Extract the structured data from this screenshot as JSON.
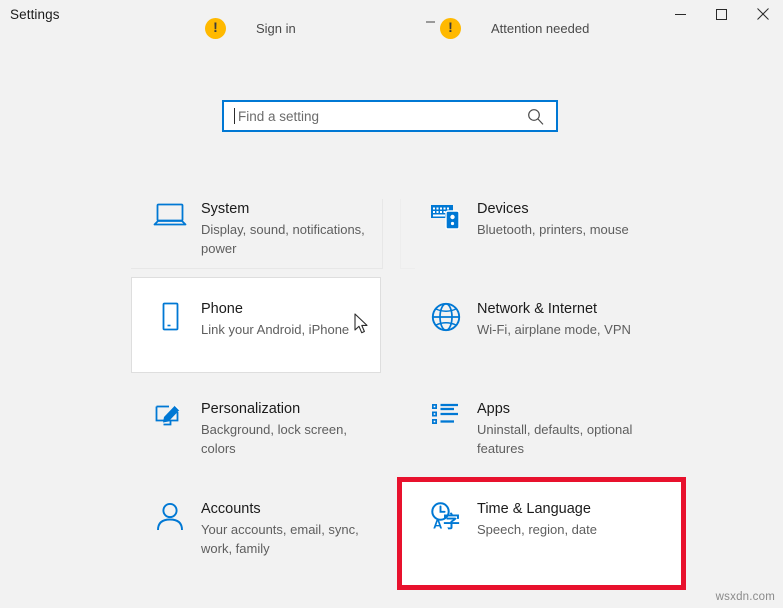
{
  "window": {
    "title": "Settings",
    "controls": [
      {
        "name": "minimize",
        "glyph": "minimize-icon"
      },
      {
        "name": "maximize",
        "glyph": "maximize-icon"
      },
      {
        "name": "close",
        "glyph": "close-icon"
      }
    ]
  },
  "header_strip": {
    "items": [
      {
        "icon": "warning-icon",
        "label": "Sign in"
      },
      {
        "icon": "warning-icon",
        "label": "Attention needed"
      }
    ]
  },
  "search": {
    "placeholder": "Find a setting",
    "value": "",
    "icon": "search-icon"
  },
  "tiles": [
    {
      "icon": "system-monitor-icon",
      "title": "System",
      "subtitle": "Display, sound, notifications, power",
      "hovered": false
    },
    {
      "icon": "devices-keyboard-icon",
      "title": "Devices",
      "subtitle": "Bluetooth, printers, mouse",
      "hovered": false
    },
    {
      "icon": "phone-icon",
      "title": "Phone",
      "subtitle": "Link your Android, iPhone",
      "hovered": true
    },
    {
      "icon": "globe-icon",
      "title": "Network & Internet",
      "subtitle": "Wi-Fi, airplane mode, VPN",
      "hovered": false
    },
    {
      "icon": "personalization-brush-icon",
      "title": "Personalization",
      "subtitle": "Background, lock screen, colors",
      "hovered": false
    },
    {
      "icon": "apps-list-icon",
      "title": "Apps",
      "subtitle": "Uninstall, defaults, optional features",
      "hovered": false
    },
    {
      "icon": "account-person-icon",
      "title": "Accounts",
      "subtitle": "Your accounts, email, sync, work, family",
      "hovered": false
    },
    {
      "icon": "time-language-icon",
      "title": "Time & Language",
      "subtitle": "Speech, region, date",
      "hovered": false,
      "annotated": true
    }
  ],
  "annotation": {
    "target": "Time & Language",
    "color": "#e8112d"
  },
  "watermark": {
    "text": "wsxdn.com"
  },
  "colors": {
    "accent": "#0078d4",
    "background": "#f2f2f2",
    "warning": "#ffb900",
    "annotation": "#e8112d"
  }
}
